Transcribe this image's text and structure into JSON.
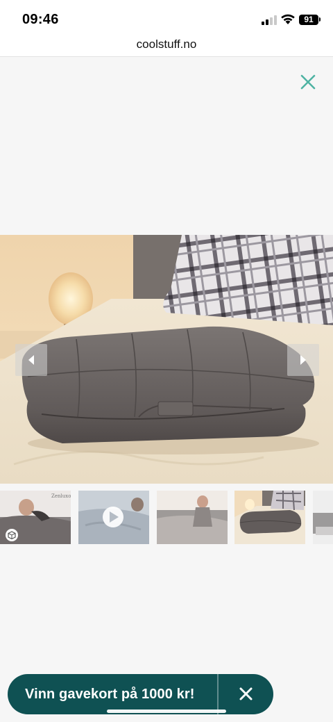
{
  "status_bar": {
    "time": "09:46",
    "battery": "91",
    "icons": [
      "signal-icon",
      "wifi-icon",
      "battery-icon"
    ]
  },
  "browser": {
    "url": "coolstuff.no"
  },
  "gallery": {
    "close_icon": "close-icon",
    "accent_color": "#4fb3a3",
    "main_image": "weighted-blanket-folded-on-bed",
    "prev_icon": "chevron-left-icon",
    "next_icon": "chevron-right-icon",
    "thumbnails": [
      {
        "name": "thumb-sleeping-man",
        "badge_icon": "cube-3d-icon",
        "watermark": "Zenluxo"
      },
      {
        "name": "thumb-video",
        "badge_icon": "play-icon"
      },
      {
        "name": "thumb-woman-on-sofa"
      },
      {
        "name": "thumb-blanket-on-bed",
        "selected": true
      },
      {
        "name": "thumb-partial"
      }
    ]
  },
  "promo": {
    "label": "Vinn gavekort på 1000 kr!",
    "close_icon": "close-icon",
    "background_color": "#0f5153"
  }
}
